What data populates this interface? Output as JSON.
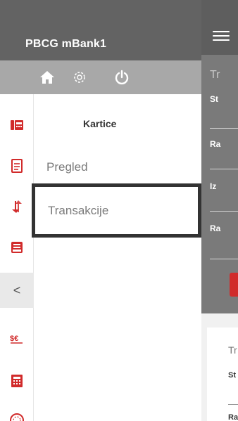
{
  "app": {
    "title": "PBCG mBank1"
  },
  "colors": {
    "accent": "#d12b2b",
    "header": "#636363",
    "iconbar": "#a8a8a8"
  },
  "iconbar": {
    "icons": [
      "home-icon",
      "settings-icon",
      "power-icon"
    ]
  },
  "rail": {
    "icons": [
      "cards-icon",
      "document-icon",
      "transfer-icon",
      "inbox-icon",
      "back-chevron-icon",
      "exchange-icon",
      "calculator-icon",
      "clock-icon"
    ],
    "back_label": "<"
  },
  "submenu": {
    "heading": "Kartice",
    "items": [
      {
        "label": "Pregled"
      },
      {
        "label": "Transakcije",
        "selected": true
      }
    ]
  },
  "background": {
    "card1": {
      "lines": [
        "Tr",
        "St",
        "Ra",
        "Iz",
        "Ra"
      ]
    },
    "card2": {
      "lines": [
        "Tr",
        "St",
        "Ra"
      ]
    }
  }
}
